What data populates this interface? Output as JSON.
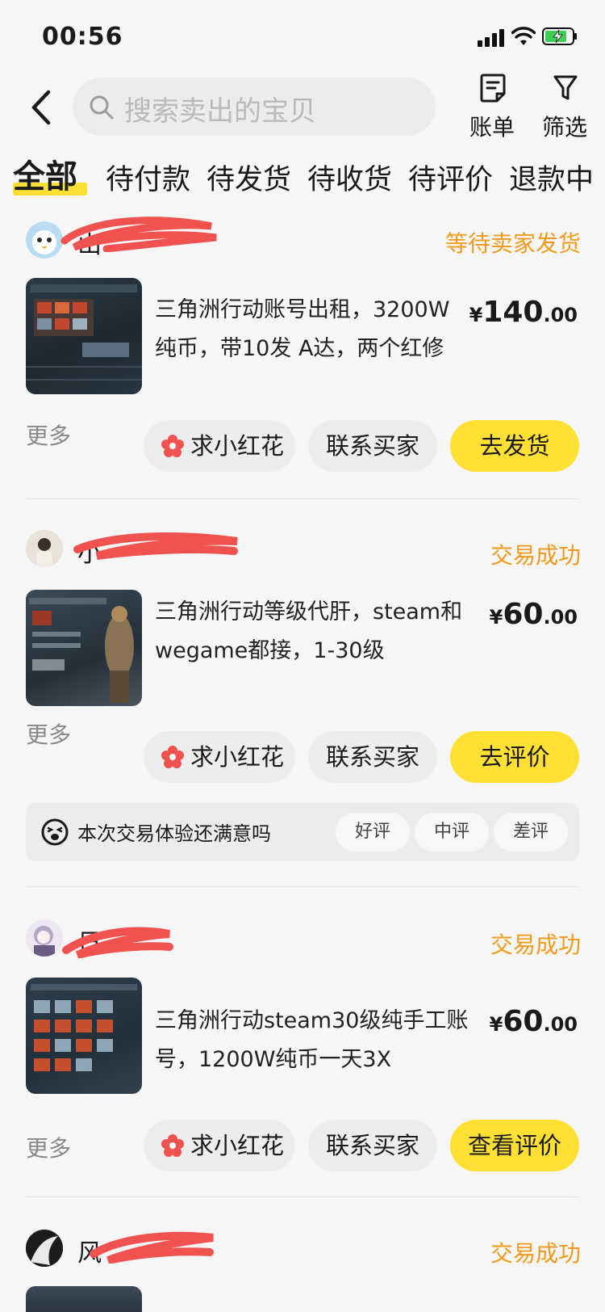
{
  "status_bar": {
    "time": "00:56"
  },
  "header": {
    "search_placeholder": "搜索卖出的宝贝",
    "bill_label": "账单",
    "filter_label": "筛选"
  },
  "tabs": [
    {
      "label": "全部",
      "active": true
    },
    {
      "label": "待付款"
    },
    {
      "label": "待发货"
    },
    {
      "label": "待收货"
    },
    {
      "label": "待评价"
    },
    {
      "label": "退款中"
    }
  ],
  "common": {
    "more": "更多",
    "flower_button": "求小红花",
    "contact_button": "联系买家"
  },
  "orders": [
    {
      "seller": "山",
      "status": "等待卖家发货",
      "title": "三角洲行动账号出租，3200W纯币，带10发 A达，两个红修",
      "price_currency": "¥",
      "price_int": "140",
      "price_dec": ".00",
      "action": "去发货"
    },
    {
      "seller": "小",
      "status": "交易成功",
      "title": "三角洲行动等级代肝，steam和wegame都接，1-30级",
      "price_currency": "¥",
      "price_int": "60",
      "price_dec": ".00",
      "action": "去评价",
      "rating": {
        "question": "本次交易体验还满意吗",
        "options": [
          "好评",
          "中评",
          "差评"
        ]
      }
    },
    {
      "seller": "日",
      "status": "交易成功",
      "title": "三角洲行动steam30级纯手工账号，1200W纯币一天3X",
      "price_currency": "¥",
      "price_int": "60",
      "price_dec": ".00",
      "action": "查看评价"
    },
    {
      "seller": "风",
      "status": "交易成功"
    }
  ],
  "colors": {
    "accent_yellow": "#ffe033",
    "status_orange": "#f19a1b",
    "redaction": "#f0524f"
  }
}
